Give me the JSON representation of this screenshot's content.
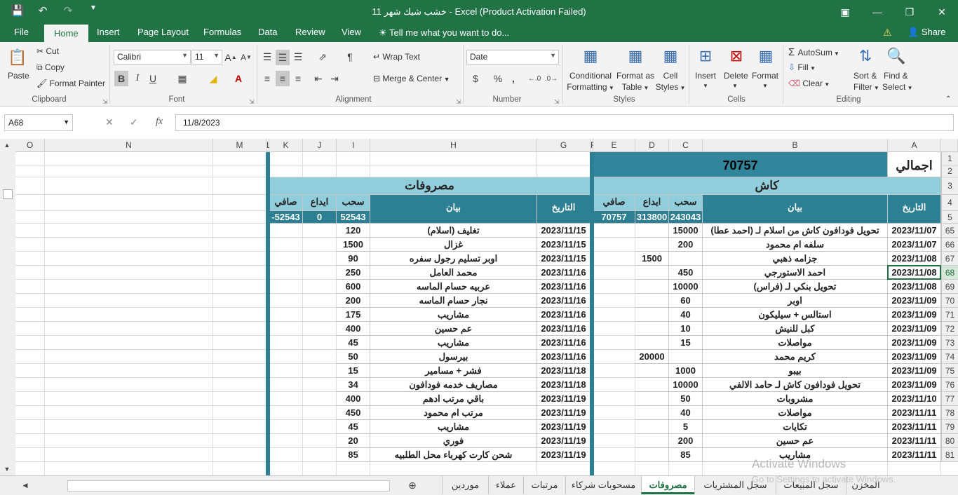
{
  "title_bar": {
    "title": "خشب شيك شهر 11 - Excel (Product Activation Failed)",
    "qat": {
      "save_icon": "save-icon",
      "undo_icon": "undo-icon",
      "redo_icon": "redo-icon",
      "customize_icon": "chevron-down-icon"
    },
    "window_controls": {
      "ribbon_display": "ribbon-display-icon",
      "minimize": "minimize-icon",
      "restore": "restore-icon",
      "close": "close-icon"
    }
  },
  "ribbon_tabs": {
    "file": "File",
    "home": "Home",
    "insert": "Insert",
    "page_layout": "Page Layout",
    "formulas": "Formulas",
    "data": "Data",
    "review": "Review",
    "view": "View",
    "tell_me": "Tell me what you want to do...",
    "share": "Share"
  },
  "ribbon": {
    "clipboard": {
      "paste": "Paste",
      "cut": "Cut",
      "copy": "Copy",
      "format_painter": "Format Painter",
      "label": "Clipboard"
    },
    "font": {
      "name": "Calibri",
      "size": "11",
      "bold": "B",
      "italic": "I",
      "underline": "U",
      "label": "Font"
    },
    "alignment": {
      "wrap_text": "Wrap Text",
      "merge_center": "Merge & Center",
      "label": "Alignment"
    },
    "number": {
      "format": "Date",
      "currency": "$",
      "percent": "%",
      "comma": ",",
      "label": "Number"
    },
    "styles": {
      "conditional": "Conditional",
      "conditional2": "Formatting",
      "format_as": "Format as",
      "format_as2": "Table",
      "cell": "Cell",
      "cell2": "Styles",
      "label": "Styles"
    },
    "cells": {
      "insert": "Insert",
      "delete": "Delete",
      "format": "Format",
      "label": "Cells"
    },
    "editing": {
      "autosum": "AutoSum",
      "fill": "Fill",
      "clear": "Clear",
      "sort": "Sort &",
      "sort2": "Filter",
      "find": "Find &",
      "find2": "Select",
      "label": "Editing"
    }
  },
  "formula_bar": {
    "name_box": "A68",
    "fx": "fx",
    "value": "11/8/2023"
  },
  "columns": [
    "O",
    "N",
    "M",
    "L",
    "K",
    "J",
    "I",
    "H",
    "G",
    "F",
    "E",
    "D",
    "C",
    "B",
    "A"
  ],
  "rows": [
    "1",
    "2",
    "3",
    "4",
    "5",
    "65",
    "66",
    "67",
    "68",
    "69",
    "70",
    "71",
    "72",
    "73",
    "74",
    "75",
    "76",
    "77",
    "78",
    "79",
    "80",
    "81"
  ],
  "sheet": {
    "total_label": "اجمالي",
    "total_value": "70757",
    "cash_header": "كاش",
    "expenses_header": "مصروفات",
    "cash_cols": {
      "date": "التاريخ",
      "desc": "بيان",
      "withdraw": "سحب",
      "deposit": "ايداع",
      "net": "صافي"
    },
    "cash_totals": {
      "withdraw": "243043",
      "deposit": "313800",
      "net": "70757"
    },
    "exp_cols": {
      "date": "التاريخ",
      "desc": "بيان",
      "withdraw": "سحب",
      "deposit": "ايداع",
      "net": "صافي"
    },
    "exp_totals": {
      "withdraw": "52543",
      "deposit": "0",
      "net": "-52543"
    },
    "cash_rows": [
      {
        "date": "2023/11/07",
        "desc": "تحويل فودافون كاش من اسلام لـ (احمد عطا)",
        "withdraw": "15000",
        "deposit": ""
      },
      {
        "date": "2023/11/07",
        "desc": "سلفه ام محمود",
        "withdraw": "200",
        "deposit": ""
      },
      {
        "date": "2023/11/08",
        "desc": "جزامه ذهبي",
        "withdraw": "",
        "deposit": "1500"
      },
      {
        "date": "2023/11/08",
        "desc": "احمد الاستورجي",
        "withdraw": "450",
        "deposit": ""
      },
      {
        "date": "2023/11/08",
        "desc": "تحويل بنكي لـ (فراس)",
        "withdraw": "10000",
        "deposit": ""
      },
      {
        "date": "2023/11/09",
        "desc": "اوبر",
        "withdraw": "60",
        "deposit": ""
      },
      {
        "date": "2023/11/09",
        "desc": "استالس + سيليكون",
        "withdraw": "40",
        "deposit": ""
      },
      {
        "date": "2023/11/09",
        "desc": "كبل للنيش",
        "withdraw": "10",
        "deposit": ""
      },
      {
        "date": "2023/11/09",
        "desc": "مواصلات",
        "withdraw": "15",
        "deposit": ""
      },
      {
        "date": "2023/11/09",
        "desc": "كريم محمد",
        "withdraw": "",
        "deposit": "20000"
      },
      {
        "date": "2023/11/09",
        "desc": "بيبو",
        "withdraw": "1000",
        "deposit": ""
      },
      {
        "date": "2023/11/09",
        "desc": "تحويل فودافون كاش لـ حامد الالفي",
        "withdraw": "10000",
        "deposit": ""
      },
      {
        "date": "2023/11/10",
        "desc": "مشروبات",
        "withdraw": "50",
        "deposit": ""
      },
      {
        "date": "2023/11/11",
        "desc": "مواصلات",
        "withdraw": "40",
        "deposit": ""
      },
      {
        "date": "2023/11/11",
        "desc": "تكايات",
        "withdraw": "5",
        "deposit": ""
      },
      {
        "date": "2023/11/11",
        "desc": "عم حسين",
        "withdraw": "200",
        "deposit": ""
      },
      {
        "date": "2023/11/11",
        "desc": "مشاريب",
        "withdraw": "85",
        "deposit": ""
      }
    ],
    "exp_rows": [
      {
        "date": "2023/11/15",
        "desc": "تغليف (اسلام)",
        "withdraw": "120"
      },
      {
        "date": "2023/11/15",
        "desc": "غزال",
        "withdraw": "1500"
      },
      {
        "date": "2023/11/15",
        "desc": "اوبر تسليم رجول سفره",
        "withdraw": "90"
      },
      {
        "date": "2023/11/16",
        "desc": "محمد العامل",
        "withdraw": "250"
      },
      {
        "date": "2023/11/16",
        "desc": "عربيه حسام الماسه",
        "withdraw": "600"
      },
      {
        "date": "2023/11/16",
        "desc": "نجار حسام الماسه",
        "withdraw": "200"
      },
      {
        "date": "2023/11/16",
        "desc": "مشاريب",
        "withdraw": "175"
      },
      {
        "date": "2023/11/16",
        "desc": "عم حسين",
        "withdraw": "400"
      },
      {
        "date": "2023/11/16",
        "desc": "مشاريب",
        "withdraw": "45"
      },
      {
        "date": "2023/11/16",
        "desc": "بيرسول",
        "withdraw": "50"
      },
      {
        "date": "2023/11/18",
        "desc": "فشر + مسامير",
        "withdraw": "15"
      },
      {
        "date": "2023/11/18",
        "desc": "مصاريف خدمه فودافون",
        "withdraw": "34"
      },
      {
        "date": "2023/11/19",
        "desc": "باقي مرتب ادهم",
        "withdraw": "400"
      },
      {
        "date": "2023/11/19",
        "desc": "مرتب ام محمود",
        "withdraw": "450"
      },
      {
        "date": "2023/11/19",
        "desc": "مشاريب",
        "withdraw": "45"
      },
      {
        "date": "2023/11/19",
        "desc": "فوري",
        "withdraw": "20"
      },
      {
        "date": "2023/11/19",
        "desc": "شحن كارت كهرباء محل الطلبيه",
        "withdraw": "85"
      }
    ]
  },
  "sheet_tabs": [
    "المخزن",
    "سجل المبيعات",
    "سجل المشتريات",
    "مصروفات",
    "مسحوبات شركاء",
    "مرتبات",
    "عملاء",
    "موردين"
  ],
  "watermark": {
    "line1": "Activate Windows",
    "line2": "Go to Settings to activate Windows."
  },
  "colors": {
    "excel_green": "#217346",
    "header_teal": "#2d7f94",
    "light_teal": "#92cddc",
    "total_fill": "#31869b"
  }
}
